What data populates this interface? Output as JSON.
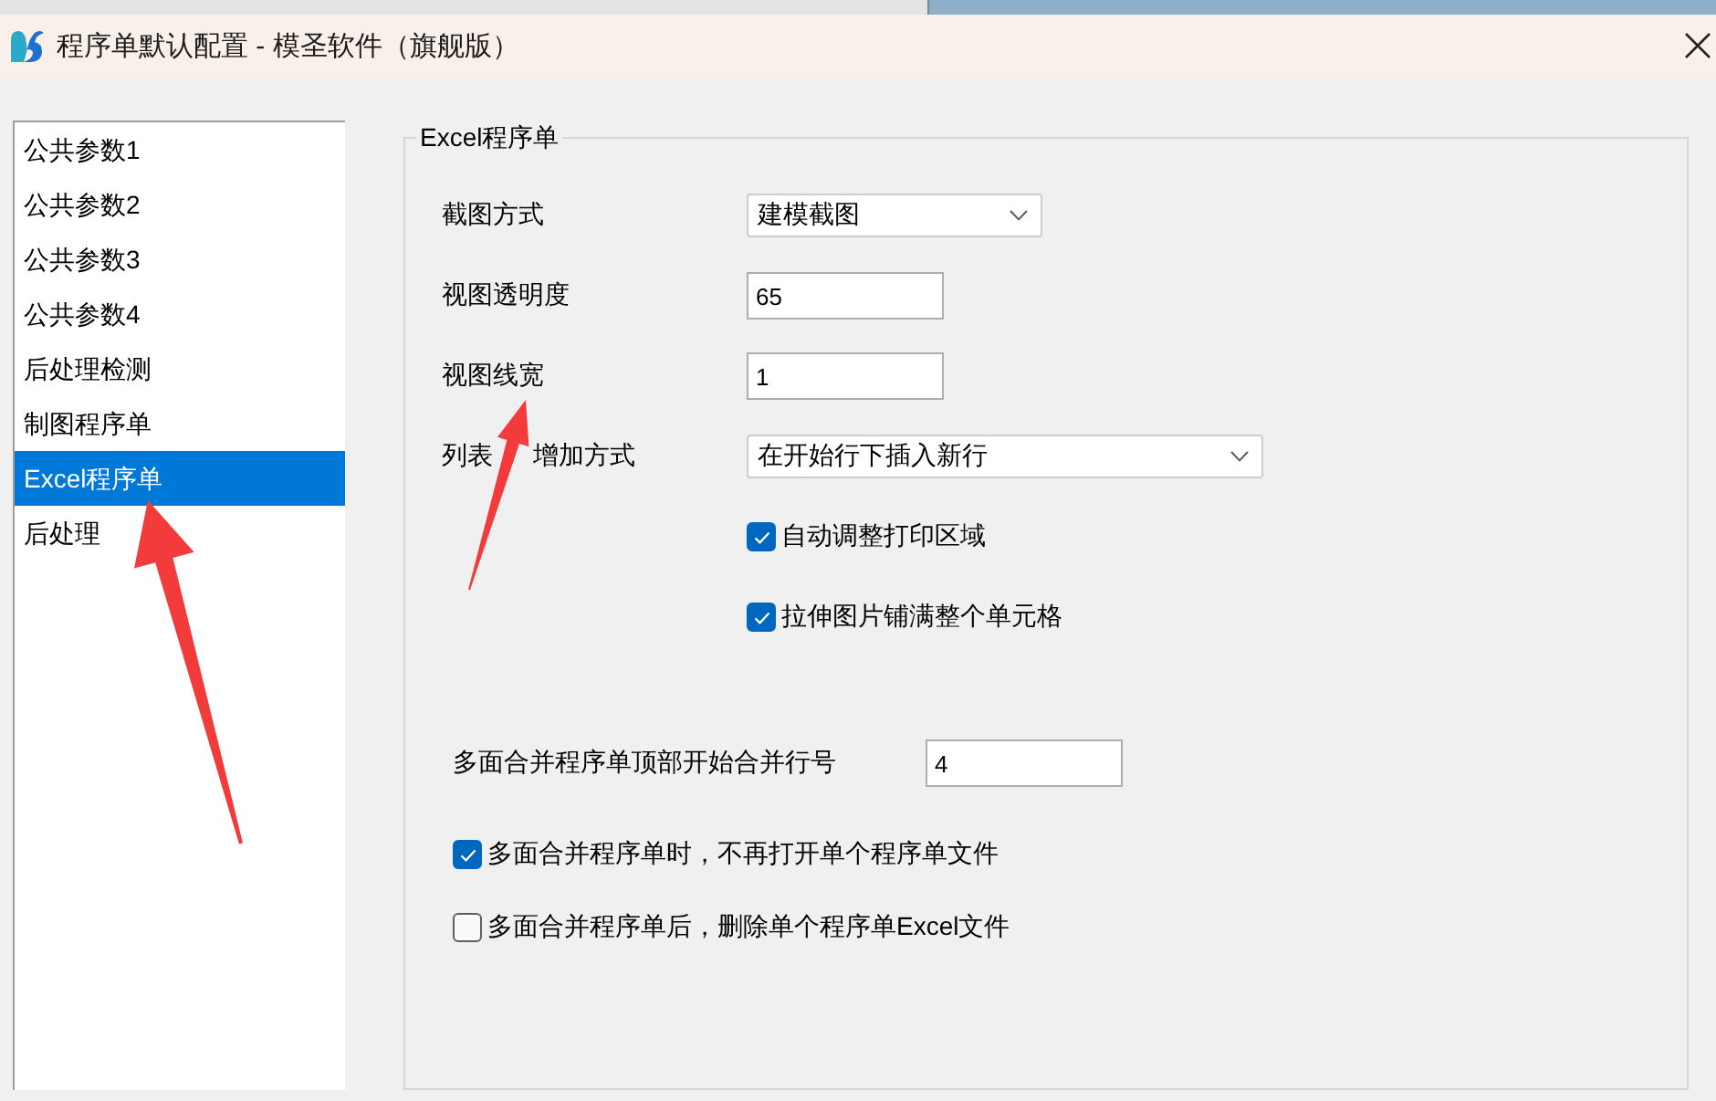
{
  "window": {
    "title": "程序单默认配置 - 模圣软件（旗舰版）"
  },
  "sidebar": {
    "items": [
      {
        "label": "公共参数1",
        "selected": false
      },
      {
        "label": "公共参数2",
        "selected": false
      },
      {
        "label": "公共参数3",
        "selected": false
      },
      {
        "label": "公共参数4",
        "selected": false
      },
      {
        "label": "后处理检测",
        "selected": false
      },
      {
        "label": "制图程序单",
        "selected": false
      },
      {
        "label": "Excel程序单",
        "selected": true
      },
      {
        "label": "后处理",
        "selected": false
      }
    ]
  },
  "group": {
    "title": "Excel程序单",
    "fields": [
      {
        "kind": "select",
        "label": "截图方式",
        "value": "建模截图"
      },
      {
        "kind": "input",
        "label": "视图透明度",
        "value": "65"
      },
      {
        "kind": "input",
        "label": "视图线宽",
        "value": "1"
      },
      {
        "kind": "select",
        "label_parts": [
          "列表",
          "增加方式"
        ],
        "value": "在开始行下插入新行"
      },
      {
        "kind": "checkbox",
        "label": "自动调整打印区域",
        "checked": true
      },
      {
        "kind": "checkbox",
        "label": "拉伸图片铺满整个单元格",
        "checked": true
      }
    ],
    "merge_fields": [
      {
        "kind": "input",
        "label": "多面合并程序单顶部开始合并行号",
        "value": "4"
      },
      {
        "kind": "checkbox",
        "label": "多面合并程序单时，不再打开单个程序单文件",
        "checked": true
      },
      {
        "kind": "checkbox",
        "label": "多面合并程序单后，删除单个程序单Excel文件",
        "checked": false
      }
    ]
  }
}
